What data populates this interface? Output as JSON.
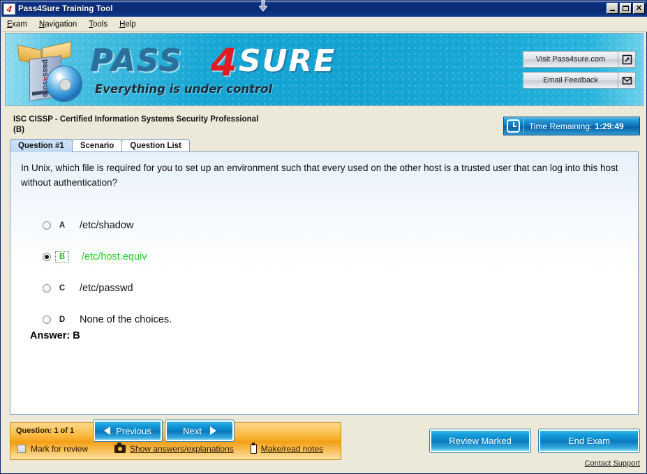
{
  "window": {
    "title": "Pass4Sure Training Tool",
    "app_icon": "pass4sure-logo-icon",
    "buttons": {
      "minimize": "minimize-button",
      "maximize": "maximize-button",
      "close": "close-button"
    }
  },
  "menu": [
    {
      "label": "Exam",
      "accel": "E"
    },
    {
      "label": "Navigation",
      "accel": "N"
    },
    {
      "label": "Tools",
      "accel": "T"
    },
    {
      "label": "Help",
      "accel": "H"
    }
  ],
  "banner": {
    "wordmark_part1": "PASS",
    "wordmark_four": "4",
    "wordmark_part2": "SURE",
    "tagline": "Everything is under control",
    "logo_box_text_pre": "pass",
    "logo_box_text_four": "4",
    "logo_box_text_post": "sure",
    "buttons": [
      {
        "label": "Visit Pass4sure.com",
        "icon": "external-link-icon"
      },
      {
        "label": "Email Feedback",
        "icon": "envelope-icon"
      }
    ]
  },
  "exam": {
    "title": "ISC CISSP - Certified Information Systems Security Professional",
    "subtitle": "(B)",
    "timer": {
      "icon": "clock-icon",
      "label": "Time Remaining:",
      "value": "1:29:49"
    }
  },
  "tabs": [
    {
      "label": "Question #1",
      "active": true
    },
    {
      "label": "Scenario",
      "active": false
    },
    {
      "label": "Question List",
      "active": false
    }
  ],
  "question": {
    "text": "In Unix, which file is required for you to set up an environment such that every used on the other host is a trusted user that can log into this host without authentication?",
    "choices": [
      {
        "letter": "A",
        "text": "/etc/shadow",
        "selected": false,
        "highlighted": false
      },
      {
        "letter": "B",
        "text": "/etc/host.equiv",
        "selected": true,
        "highlighted": true
      },
      {
        "letter": "C",
        "text": "/etc/passwd",
        "selected": false,
        "highlighted": false
      },
      {
        "letter": "D",
        "text": "None of the choices.",
        "selected": false,
        "highlighted": false
      }
    ],
    "answer_label": "Answer: B"
  },
  "footer": {
    "question_count": "Question: 1 of 1",
    "mark_for_review": "Mark for review",
    "show_answers": "Show answers/explanations",
    "show_answers_icon": "camera-icon",
    "make_notes": "Make/read notes",
    "make_notes_icon": "notepad-icon",
    "previous": "Previous",
    "next": "Next",
    "review_marked": "Review Marked",
    "end_exam": "End Exam",
    "contact_support": "Contact Support"
  },
  "colors": {
    "titlebar": "#0a2a72",
    "banner_blue": "#16a6d4",
    "accent_button": "#0a7fc4",
    "orange_panel": "#f49f18",
    "correct_green": "#22d022",
    "answer_red": "#e01b22"
  }
}
